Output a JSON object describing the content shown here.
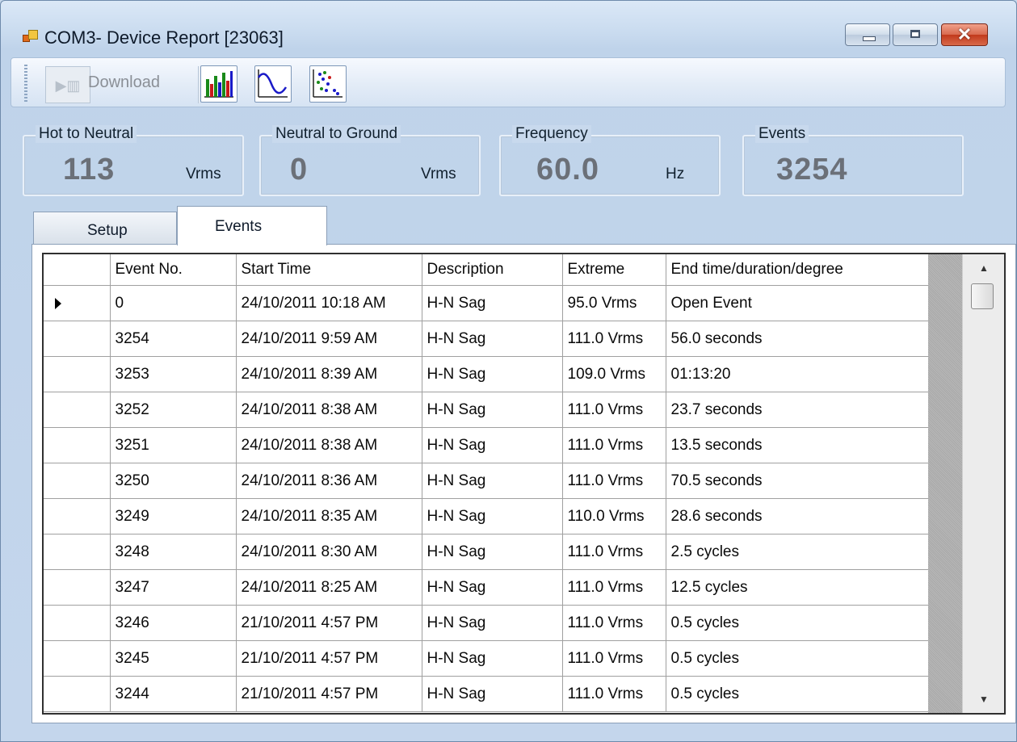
{
  "window": {
    "title": "COM3- Device Report [23063]"
  },
  "toolbar": {
    "download_label": "Download",
    "buttons": [
      {
        "icon": "bar-chart-icon"
      },
      {
        "icon": "waveform-chart-icon"
      },
      {
        "icon": "scatter-plot-icon"
      }
    ]
  },
  "readouts": {
    "hot_to_neutral": {
      "label": "Hot to Neutral",
      "value": "113",
      "unit": "Vrms"
    },
    "neutral_to_ground": {
      "label": "Neutral to Ground",
      "value": "0",
      "unit": "Vrms"
    },
    "frequency": {
      "label": "Frequency",
      "value": "60.0",
      "unit": "Hz"
    },
    "events": {
      "label": "Events",
      "value": "3254"
    }
  },
  "tabs": {
    "setup": "Setup",
    "events": "Events"
  },
  "grid": {
    "columns": [
      "Event No.",
      "Start Time",
      "Description",
      "Extreme",
      "End time/duration/degree"
    ],
    "rows": [
      [
        "0",
        "24/10/2011 10:18 AM",
        "H-N Sag",
        "95.0 Vrms",
        "Open Event"
      ],
      [
        "3254",
        "24/10/2011 9:59 AM",
        "H-N Sag",
        "111.0 Vrms",
        "56.0 seconds"
      ],
      [
        "3253",
        "24/10/2011 8:39 AM",
        "H-N Sag",
        "109.0 Vrms",
        "01:13:20"
      ],
      [
        "3252",
        "24/10/2011 8:38 AM",
        "H-N Sag",
        "111.0 Vrms",
        "23.7 seconds"
      ],
      [
        "3251",
        "24/10/2011 8:38 AM",
        "H-N Sag",
        "111.0 Vrms",
        "13.5 seconds"
      ],
      [
        "3250",
        "24/10/2011 8:36 AM",
        "H-N Sag",
        "111.0 Vrms",
        "70.5 seconds"
      ],
      [
        "3249",
        "24/10/2011 8:35 AM",
        "H-N Sag",
        "110.0 Vrms",
        "28.6 seconds"
      ],
      [
        "3248",
        "24/10/2011 8:30 AM",
        "H-N Sag",
        "111.0 Vrms",
        "2.5 cycles"
      ],
      [
        "3247",
        "24/10/2011 8:25 AM",
        "H-N Sag",
        "111.0 Vrms",
        "12.5 cycles"
      ],
      [
        "3246",
        "21/10/2011 4:57 PM",
        "H-N Sag",
        "111.0 Vrms",
        "0.5 cycles"
      ],
      [
        "3245",
        "21/10/2011 4:57 PM",
        "H-N Sag",
        "111.0 Vrms",
        "0.5 cycles"
      ],
      [
        "3244",
        "21/10/2011 4:57 PM",
        "H-N Sag",
        "111.0 Vrms",
        "0.5 cycles"
      ]
    ]
  }
}
